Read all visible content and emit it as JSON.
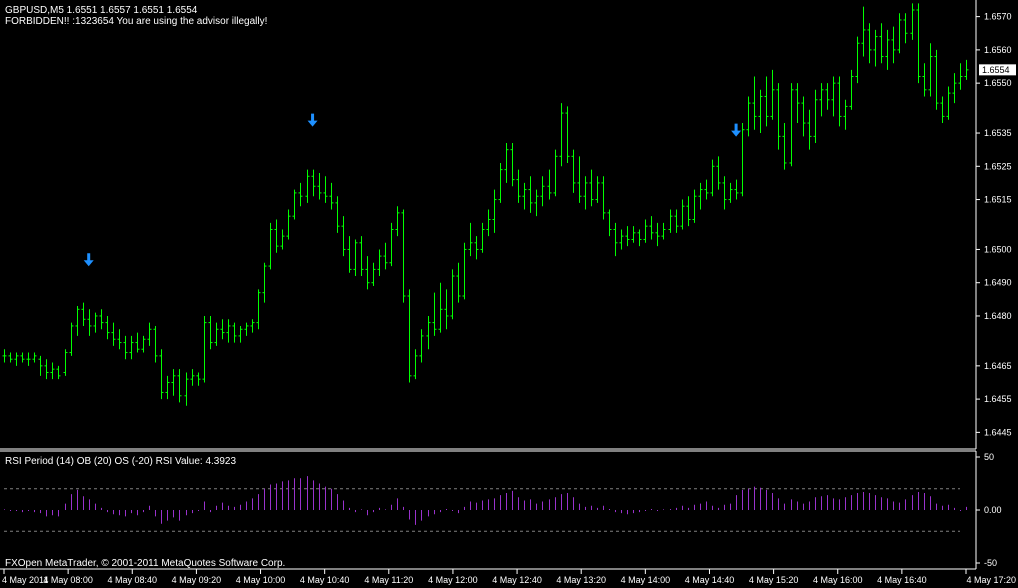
{
  "header": {
    "symbol_line": "GBPUSD,M5  1.6551 1.6557 1.6551 1.6554",
    "warning": "FORBIDDEN!! :1323654 You are using the advisor illegally!"
  },
  "indicator": {
    "label": "RSI Period (14) OB (20) OS (-20) RSI Value: 4.3923"
  },
  "footer": {
    "copyright": "FXOpen MetaTrader, © 2001-2011 MetaQuotes Software Corp."
  },
  "colors": {
    "background": "#000000",
    "bar": "#00ff00",
    "arrow": "#1e90ff",
    "rsi": "#9932cc",
    "axis": "#ffffff",
    "level": "#808080"
  },
  "icons": {
    "signal_arrow": "arrow-down-icon"
  },
  "chart_data": [
    {
      "type": "ohlc",
      "title": "GBPUSD,M5",
      "ylim": [
        1.644,
        1.6575
      ],
      "y_ticks": [
        "1.6570",
        "1.6560",
        "1.6550",
        "1.6535",
        "1.6525",
        "1.6515",
        "1.6500",
        "1.6490",
        "1.6480",
        "1.6465",
        "1.6455",
        "1.6445"
      ],
      "current_price": "1.6554",
      "x_ticks": [
        "4 May 2011",
        "4 May 08:00",
        "4 May 08:40",
        "4 May 09:20",
        "4 May 10:00",
        "4 May 10:40",
        "4 May 11:20",
        "4 May 12:00",
        "4 May 12:40",
        "4 May 13:20",
        "4 May 14:00",
        "4 May 14:40",
        "4 May 15:20",
        "4 May 16:00",
        "4 May 16:40",
        "4 May 17:20"
      ],
      "signal_arrows_at_bar": [
        14,
        51,
        121
      ],
      "bars": [
        [
          1.6468,
          1.647,
          1.6466,
          1.6468
        ],
        [
          1.6468,
          1.6469,
          1.6466,
          1.6467
        ],
        [
          1.6467,
          1.6469,
          1.6465,
          1.6468
        ],
        [
          1.6468,
          1.6469,
          1.6466,
          1.6467
        ],
        [
          1.6467,
          1.6469,
          1.6465,
          1.6467
        ],
        [
          1.6467,
          1.6469,
          1.6466,
          1.6468
        ],
        [
          1.6467,
          1.6468,
          1.6462,
          1.6465
        ],
        [
          1.6465,
          1.6467,
          1.6461,
          1.6463
        ],
        [
          1.6463,
          1.6466,
          1.6461,
          1.6464
        ],
        [
          1.6464,
          1.6465,
          1.6461,
          1.6462
        ],
        [
          1.6463,
          1.647,
          1.6462,
          1.6469
        ],
        [
          1.6469,
          1.6478,
          1.6468,
          1.6477
        ],
        [
          1.6477,
          1.6483,
          1.6474,
          1.6482
        ],
        [
          1.6482,
          1.6484,
          1.6477,
          1.6479
        ],
        [
          1.6479,
          1.6482,
          1.6474,
          1.6477
        ],
        [
          1.6477,
          1.6481,
          1.6475,
          1.648
        ],
        [
          1.648,
          1.6482,
          1.6476,
          1.6478
        ],
        [
          1.6478,
          1.648,
          1.6473,
          1.6475
        ],
        [
          1.6475,
          1.6478,
          1.6471,
          1.6473
        ],
        [
          1.6473,
          1.6476,
          1.647,
          1.6472
        ],
        [
          1.6472,
          1.6474,
          1.6467,
          1.6469
        ],
        [
          1.6469,
          1.6474,
          1.6467,
          1.6472
        ],
        [
          1.6472,
          1.6475,
          1.6469,
          1.647
        ],
        [
          1.647,
          1.6474,
          1.6469,
          1.6473
        ],
        [
          1.6473,
          1.6478,
          1.6471,
          1.6476
        ],
        [
          1.6476,
          1.6477,
          1.6466,
          1.6468
        ],
        [
          1.6468,
          1.647,
          1.6455,
          1.6457
        ],
        [
          1.6457,
          1.6462,
          1.6455,
          1.646
        ],
        [
          1.646,
          1.6464,
          1.6456,
          1.6462
        ],
        [
          1.6462,
          1.6464,
          1.6454,
          1.6456
        ],
        [
          1.6456,
          1.6463,
          1.6453,
          1.6461
        ],
        [
          1.6461,
          1.6464,
          1.6459,
          1.6462
        ],
        [
          1.6462,
          1.6463,
          1.6459,
          1.6461
        ],
        [
          1.6461,
          1.648,
          1.646,
          1.6478
        ],
        [
          1.6478,
          1.648,
          1.647,
          1.6472
        ],
        [
          1.6472,
          1.6478,
          1.6471,
          1.6476
        ],
        [
          1.6476,
          1.6479,
          1.6473,
          1.6475
        ],
        [
          1.6475,
          1.6479,
          1.6472,
          1.6477
        ],
        [
          1.6477,
          1.6478,
          1.6472,
          1.6474
        ],
        [
          1.6474,
          1.6477,
          1.6472,
          1.6476
        ],
        [
          1.6476,
          1.6478,
          1.6474,
          1.6477
        ],
        [
          1.6477,
          1.6479,
          1.6475,
          1.6478
        ],
        [
          1.6478,
          1.6488,
          1.6476,
          1.6487
        ],
        [
          1.6487,
          1.6496,
          1.6484,
          1.6495
        ],
        [
          1.6495,
          1.6508,
          1.6494,
          1.6506
        ],
        [
          1.6506,
          1.6509,
          1.6499,
          1.6501
        ],
        [
          1.6501,
          1.6506,
          1.65,
          1.6504
        ],
        [
          1.6504,
          1.6512,
          1.6503,
          1.651
        ],
        [
          1.651,
          1.6518,
          1.6509,
          1.6517
        ],
        [
          1.6517,
          1.652,
          1.6513,
          1.6516
        ],
        [
          1.6516,
          1.6524,
          1.6514,
          1.6522
        ],
        [
          1.6522,
          1.6524,
          1.6516,
          1.6519
        ],
        [
          1.6519,
          1.6523,
          1.6515,
          1.6517
        ],
        [
          1.6517,
          1.6522,
          1.6514,
          1.6516
        ],
        [
          1.6516,
          1.652,
          1.6512,
          1.6514
        ],
        [
          1.6514,
          1.6516,
          1.6505,
          1.6507
        ],
        [
          1.6507,
          1.651,
          1.6498,
          1.65
        ],
        [
          1.65,
          1.6504,
          1.6493,
          1.6494
        ],
        [
          1.6494,
          1.6503,
          1.6492,
          1.6502
        ],
        [
          1.6502,
          1.6504,
          1.6492,
          1.6494
        ],
        [
          1.6494,
          1.6498,
          1.6488,
          1.649
        ],
        [
          1.649,
          1.6496,
          1.6489,
          1.6494
        ],
        [
          1.6494,
          1.65,
          1.6492,
          1.6498
        ],
        [
          1.6498,
          1.6502,
          1.6494,
          1.6496
        ],
        [
          1.6496,
          1.6508,
          1.6495,
          1.6506
        ],
        [
          1.6506,
          1.6513,
          1.6504,
          1.6511
        ],
        [
          1.6511,
          1.6512,
          1.6484,
          1.6486
        ],
        [
          1.6486,
          1.6488,
          1.646,
          1.6462
        ],
        [
          1.6462,
          1.647,
          1.6461,
          1.6468
        ],
        [
          1.6468,
          1.6476,
          1.6466,
          1.6474
        ],
        [
          1.6474,
          1.648,
          1.647,
          1.6478
        ],
        [
          1.6478,
          1.6487,
          1.6474,
          1.6476
        ],
        [
          1.6476,
          1.649,
          1.6475,
          1.6482
        ],
        [
          1.6482,
          1.6488,
          1.6476,
          1.648
        ],
        [
          1.648,
          1.6494,
          1.6479,
          1.6492
        ],
        [
          1.6492,
          1.6496,
          1.6484,
          1.6486
        ],
        [
          1.6486,
          1.6502,
          1.6485,
          1.65
        ],
        [
          1.65,
          1.6508,
          1.6498,
          1.6502
        ],
        [
          1.6502,
          1.6504,
          1.6497,
          1.65
        ],
        [
          1.65,
          1.6508,
          1.6499,
          1.6506
        ],
        [
          1.6506,
          1.6512,
          1.6504,
          1.6509
        ],
        [
          1.6509,
          1.6518,
          1.6505,
          1.6515
        ],
        [
          1.6515,
          1.6526,
          1.6514,
          1.6524
        ],
        [
          1.6524,
          1.6532,
          1.652,
          1.653
        ],
        [
          1.653,
          1.6532,
          1.6519,
          1.6521
        ],
        [
          1.6521,
          1.6524,
          1.6514,
          1.6516
        ],
        [
          1.6516,
          1.652,
          1.6512,
          1.6518
        ],
        [
          1.6518,
          1.6522,
          1.6511,
          1.6514
        ],
        [
          1.6514,
          1.6518,
          1.651,
          1.6516
        ],
        [
          1.6516,
          1.6522,
          1.6513,
          1.6519
        ],
        [
          1.6519,
          1.6524,
          1.6515,
          1.6517
        ],
        [
          1.6517,
          1.653,
          1.6516,
          1.6528
        ],
        [
          1.6528,
          1.6544,
          1.6525,
          1.6541
        ],
        [
          1.6541,
          1.6543,
          1.6526,
          1.6528
        ],
        [
          1.6528,
          1.653,
          1.6517,
          1.652
        ],
        [
          1.652,
          1.6528,
          1.6514,
          1.6516
        ],
        [
          1.6516,
          1.6522,
          1.6512,
          1.652
        ],
        [
          1.652,
          1.6524,
          1.6513,
          1.6515
        ],
        [
          1.6515,
          1.6522,
          1.6514,
          1.652
        ],
        [
          1.652,
          1.6522,
          1.6509,
          1.6511
        ],
        [
          1.6511,
          1.6512,
          1.6504,
          1.6506
        ],
        [
          1.6506,
          1.6508,
          1.6498,
          1.6502
        ],
        [
          1.6502,
          1.6506,
          1.65,
          1.6504
        ],
        [
          1.6504,
          1.6507,
          1.6501,
          1.6503
        ],
        [
          1.6503,
          1.6507,
          1.6502,
          1.6505
        ],
        [
          1.6505,
          1.6506,
          1.6501,
          1.6503
        ],
        [
          1.6503,
          1.6509,
          1.6502,
          1.6507
        ],
        [
          1.6507,
          1.651,
          1.6503,
          1.6505
        ],
        [
          1.6505,
          1.6508,
          1.6501,
          1.6504
        ],
        [
          1.6504,
          1.6508,
          1.6503,
          1.6506
        ],
        [
          1.6506,
          1.6512,
          1.6505,
          1.651
        ],
        [
          1.651,
          1.6512,
          1.6505,
          1.6507
        ],
        [
          1.6507,
          1.6515,
          1.6506,
          1.6513
        ],
        [
          1.6513,
          1.6516,
          1.6507,
          1.6509
        ],
        [
          1.6509,
          1.6518,
          1.6508,
          1.6516
        ],
        [
          1.6516,
          1.652,
          1.6512,
          1.6518
        ],
        [
          1.6518,
          1.6521,
          1.6515,
          1.6517
        ],
        [
          1.6517,
          1.6527,
          1.6516,
          1.6525
        ],
        [
          1.6525,
          1.6528,
          1.6518,
          1.652
        ],
        [
          1.652,
          1.6522,
          1.6512,
          1.6515
        ],
        [
          1.6515,
          1.652,
          1.6514,
          1.6518
        ],
        [
          1.6518,
          1.6521,
          1.6515,
          1.6517
        ],
        [
          1.6517,
          1.6538,
          1.6516,
          1.6536
        ],
        [
          1.6536,
          1.6546,
          1.6534,
          1.6544
        ],
        [
          1.6544,
          1.6552,
          1.6536,
          1.654
        ],
        [
          1.654,
          1.6548,
          1.6535,
          1.6546
        ],
        [
          1.6546,
          1.6552,
          1.6537,
          1.654
        ],
        [
          1.654,
          1.6554,
          1.6539,
          1.6548
        ],
        [
          1.6548,
          1.655,
          1.653,
          1.6534
        ],
        [
          1.6534,
          1.6538,
          1.6524,
          1.6526
        ],
        [
          1.6526,
          1.655,
          1.6525,
          1.6548
        ],
        [
          1.6548,
          1.655,
          1.6538,
          1.6544
        ],
        [
          1.6544,
          1.6546,
          1.6534,
          1.6538
        ],
        [
          1.6538,
          1.6542,
          1.653,
          1.6534
        ],
        [
          1.6534,
          1.6548,
          1.6532,
          1.6545
        ],
        [
          1.6545,
          1.655,
          1.654,
          1.6548
        ],
        [
          1.6548,
          1.655,
          1.6542,
          1.6545
        ],
        [
          1.6545,
          1.6552,
          1.654,
          1.655
        ],
        [
          1.655,
          1.6552,
          1.6537,
          1.654
        ],
        [
          1.654,
          1.6545,
          1.6536,
          1.6543
        ],
        [
          1.6543,
          1.6554,
          1.6542,
          1.6552
        ],
        [
          1.6552,
          1.6564,
          1.655,
          1.6562
        ],
        [
          1.6562,
          1.6573,
          1.6558,
          1.6566
        ],
        [
          1.6566,
          1.6568,
          1.6556,
          1.656
        ],
        [
          1.656,
          1.6566,
          1.6555,
          1.6564
        ],
        [
          1.6564,
          1.6568,
          1.6556,
          1.6558
        ],
        [
          1.6558,
          1.6566,
          1.6554,
          1.6563
        ],
        [
          1.6563,
          1.6567,
          1.6556,
          1.656
        ],
        [
          1.656,
          1.6571,
          1.6559,
          1.6569
        ],
        [
          1.6569,
          1.6571,
          1.6562,
          1.6565
        ],
        [
          1.6565,
          1.6574,
          1.6563,
          1.6572
        ],
        [
          1.6572,
          1.6574,
          1.655,
          1.6552
        ],
        [
          1.6552,
          1.6556,
          1.6546,
          1.6548
        ],
        [
          1.6548,
          1.6562,
          1.6546,
          1.6558
        ],
        [
          1.6558,
          1.656,
          1.6542,
          1.6544
        ],
        [
          1.6544,
          1.6546,
          1.6538,
          1.654
        ],
        [
          1.654,
          1.6549,
          1.6539,
          1.6547
        ],
        [
          1.6547,
          1.6553,
          1.6544,
          1.655
        ],
        [
          1.655,
          1.6556,
          1.6548,
          1.6552
        ],
        [
          1.6552,
          1.6557,
          1.6551,
          1.6554
        ]
      ]
    },
    {
      "type": "histogram",
      "title": "RSI Period (14) OB (20) OS (-20) RSI Value: 4.3923",
      "ylim": [
        -50,
        50
      ],
      "levels": [
        20,
        -20
      ],
      "y_ticks": [
        "50",
        "0.00",
        "-50"
      ],
      "values": [
        0,
        -1,
        -1,
        -2,
        -1,
        -2,
        -3,
        -6,
        -5,
        -6,
        6,
        15,
        19,
        13,
        10,
        6,
        2,
        -2,
        -4,
        -5,
        -6,
        -3,
        -5,
        -2,
        4,
        -6,
        -13,
        -10,
        -7,
        -10,
        -5,
        -3,
        -1,
        8,
        -2,
        4,
        7,
        4,
        3,
        5,
        8,
        11,
        15,
        20,
        24,
        25,
        27,
        28,
        30,
        30,
        32,
        28,
        25,
        22,
        20,
        15,
        9,
        2,
        -2,
        0,
        -5,
        -2,
        2,
        0,
        5,
        11,
        3,
        -9,
        -14,
        -10,
        -6,
        -4,
        -2,
        1,
        -1,
        -3,
        3,
        8,
        7,
        9,
        10,
        11,
        14,
        16,
        18,
        12,
        9,
        10,
        6,
        8,
        10,
        12,
        15,
        16,
        12,
        6,
        3,
        4,
        2,
        4,
        1,
        -2,
        -3,
        -4,
        -3,
        -2,
        -1,
        1,
        -1,
        0,
        1,
        2,
        4,
        2,
        5,
        6,
        8,
        4,
        2,
        5,
        6,
        14,
        19,
        20,
        22,
        21,
        19,
        16,
        11,
        6,
        10,
        8,
        6,
        8,
        12,
        13,
        14,
        11,
        10,
        12,
        14,
        16,
        17,
        16,
        14,
        12,
        11,
        8,
        7,
        10,
        14,
        17,
        16,
        13,
        6,
        4,
        5,
        2,
        -1,
        3
      ]
    }
  ]
}
